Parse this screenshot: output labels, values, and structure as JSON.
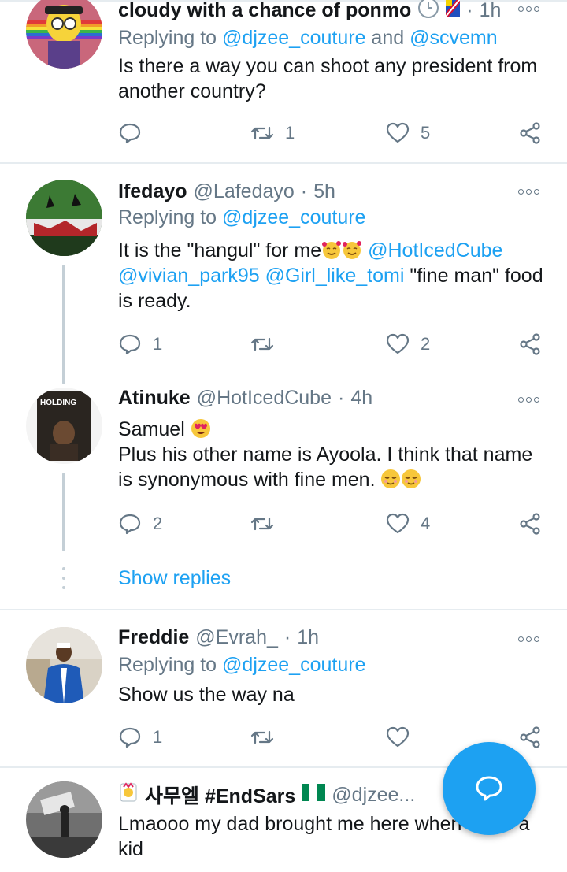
{
  "tweets": [
    {
      "name": "cloudy with a chance of ponmo",
      "time": "1h",
      "replying_label": "Replying to",
      "replying_mentions": [
        "@djzee_couture",
        "@scvemn"
      ],
      "replying_joiner": "and",
      "text": "Is there a way you can shoot any president from another country?",
      "replies": "",
      "retweets": "1",
      "likes": "5"
    },
    {
      "name": "Ifedayo",
      "handle": "@Lafedayo",
      "time": "5h",
      "replying_label": "Replying to",
      "replying_mentions": [
        "@djzee_couture"
      ],
      "text_before": "It is the \"hangul\"  for me",
      "text_mentions": [
        "@HotIcedCube",
        "@vivian_park95",
        "@Girl_like_tomi"
      ],
      "text_after": "\"fine man\" food is ready.",
      "replies": "1",
      "retweets": "",
      "likes": "2"
    },
    {
      "name": "Atinuke",
      "handle": "@HotIcedCube",
      "time": "4h",
      "line1": "Samuel",
      "line2": "Plus his other name is Ayoola. I think that name is synonymous with fine men.",
      "avatar_text": "HOLDING",
      "replies": "2",
      "retweets": "",
      "likes": "4",
      "show_replies": "Show replies"
    },
    {
      "name": "Freddie",
      "handle": "@Evrah_",
      "time": "1h",
      "replying_label": "Replying to",
      "replying_mentions": [
        "@djzee_couture"
      ],
      "text": "Show us the way na",
      "replies": "1",
      "retweets": "",
      "likes": ""
    },
    {
      "name": "사무엘 #EndSars",
      "handle": "@djzee...",
      "text": "Lmaooo my dad brought me here when I was a kid"
    }
  ],
  "colors": {
    "accent": "#1da1f2",
    "secondary_text": "#657786",
    "divider": "#e6ecf0"
  },
  "icons": [
    "reply-icon",
    "retweet-icon",
    "like-icon",
    "share-icon",
    "more-icon",
    "compose-reply-icon"
  ]
}
